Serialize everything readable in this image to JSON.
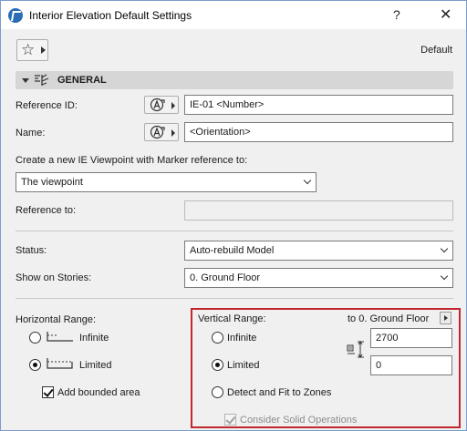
{
  "window": {
    "title": "Interior Elevation Default Settings",
    "help_glyph": "?",
    "close_glyph": "✕"
  },
  "toolbar": {
    "favorites_icon": "star-icon",
    "default_label": "Default"
  },
  "general_panel": {
    "label": "GENERAL",
    "reference_id": {
      "label": "Reference ID:",
      "value": "IE-01 <Number>"
    },
    "name": {
      "label": "Name:",
      "value": "<Orientation>"
    },
    "marker_ref": {
      "label": "Create a new IE Viewpoint with Marker reference to:",
      "selected": "The viewpoint"
    },
    "reference_to": {
      "label": "Reference to:",
      "value": ""
    },
    "status": {
      "label": "Status:",
      "selected": "Auto-rebuild Model"
    },
    "show_on_stories": {
      "label": "Show on Stories:",
      "selected": "0. Ground Floor"
    }
  },
  "horizontal_range": {
    "label": "Horizontal Range:",
    "options": [
      {
        "label": "Infinite",
        "selected": false
      },
      {
        "label": "Limited",
        "selected": true
      }
    ],
    "add_bounded_area": {
      "label": "Add bounded area",
      "checked": true
    }
  },
  "vertical_range": {
    "label": "Vertical Range:",
    "to_story": "to 0. Ground Floor",
    "options": [
      {
        "label": "Infinite",
        "selected": false
      },
      {
        "label": "Limited",
        "selected": true
      },
      {
        "label": "Detect and Fit to Zones",
        "selected": false
      }
    ],
    "top_value": "2700",
    "bottom_value": "0",
    "consider_solid_operations": {
      "label": "Consider Solid Operations",
      "checked": true,
      "enabled": false
    }
  },
  "colors": {
    "highlight_border": "#c0282d",
    "panel_header": "#d6d6d6",
    "window_bg": "#f0f0f0"
  }
}
